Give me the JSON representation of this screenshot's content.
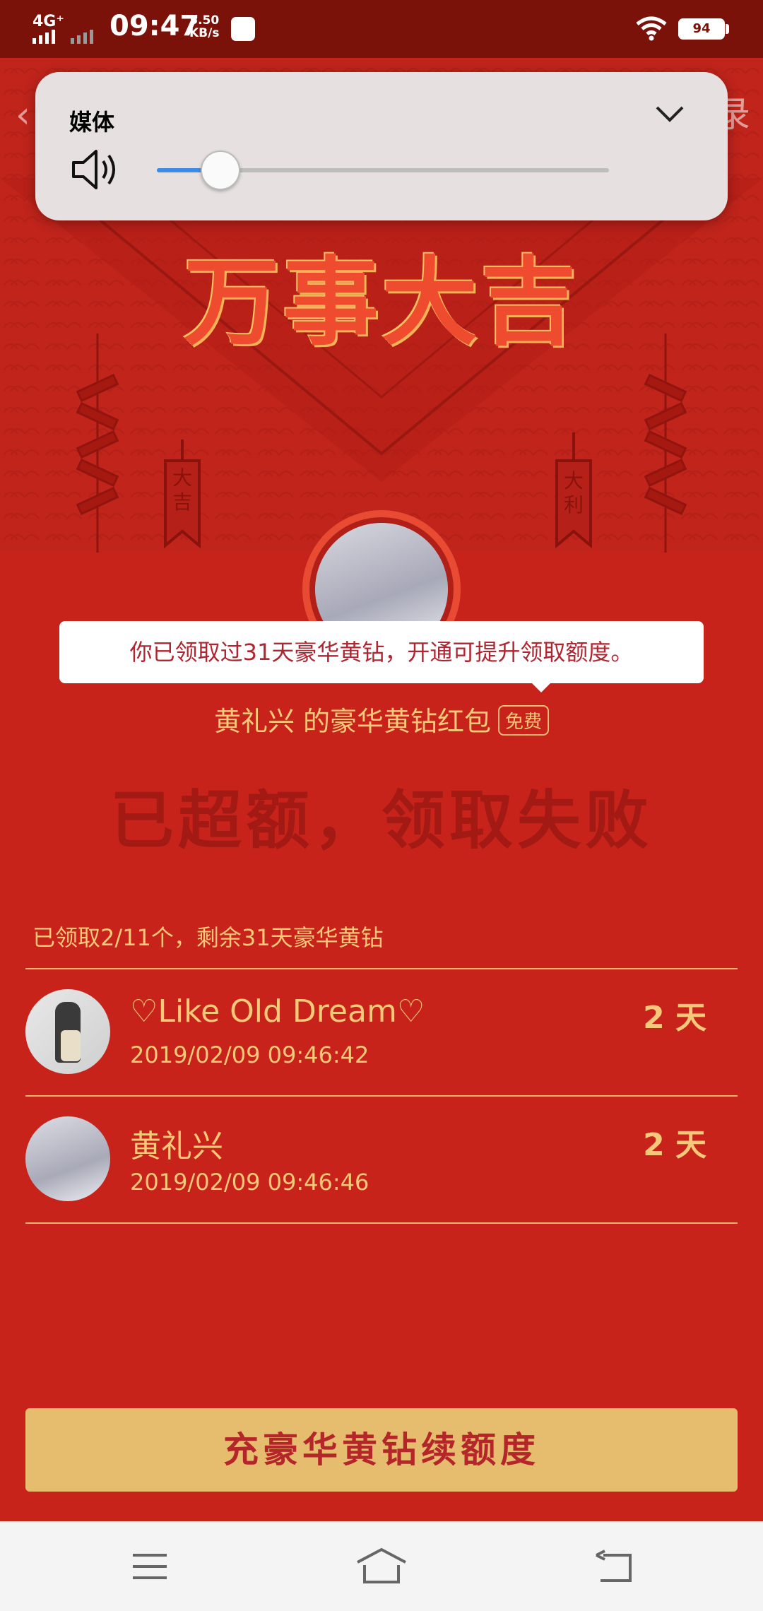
{
  "status_bar": {
    "network": "4G⁺",
    "time": "09:47",
    "speed_value": "5.50",
    "speed_unit": "KB/s",
    "battery": "94"
  },
  "nav": {
    "back_label": "返回",
    "record_label": "红包记录"
  },
  "volume_panel": {
    "label": "媒体",
    "level": 0.14
  },
  "hero": {
    "title": "万事大吉",
    "banner_left": "大吉",
    "banner_right": "大利"
  },
  "tooltip": "你已领取过31天豪华黄钻，开通可提升领取额度。",
  "sender_line": "黄礼兴  的豪华黄钻红包",
  "free_badge": "免费",
  "status_message": "已超额，领取失败",
  "summary": "已领取2/11个，剩余31天豪华黄钻",
  "records": [
    {
      "name": "♡Like Old Dream♡",
      "time": "2019/02/09 09:46:42",
      "amount": "2 天"
    },
    {
      "name": "黄礼兴",
      "time": "2019/02/09 09:46:46",
      "amount": "2 天"
    }
  ],
  "cta_label": "充豪华黄钻续额度",
  "colors": {
    "background": "#c8231b",
    "gold_text": "#f6c879",
    "cta_bg": "#e6bd6e",
    "cta_text": "#b5262a"
  },
  "icons": {
    "back": "chevron-left-icon",
    "volume": "speaker-icon",
    "collapse": "chevron-down-icon",
    "menu": "menu-icon",
    "home": "home-icon",
    "return": "back-arrow-icon"
  }
}
